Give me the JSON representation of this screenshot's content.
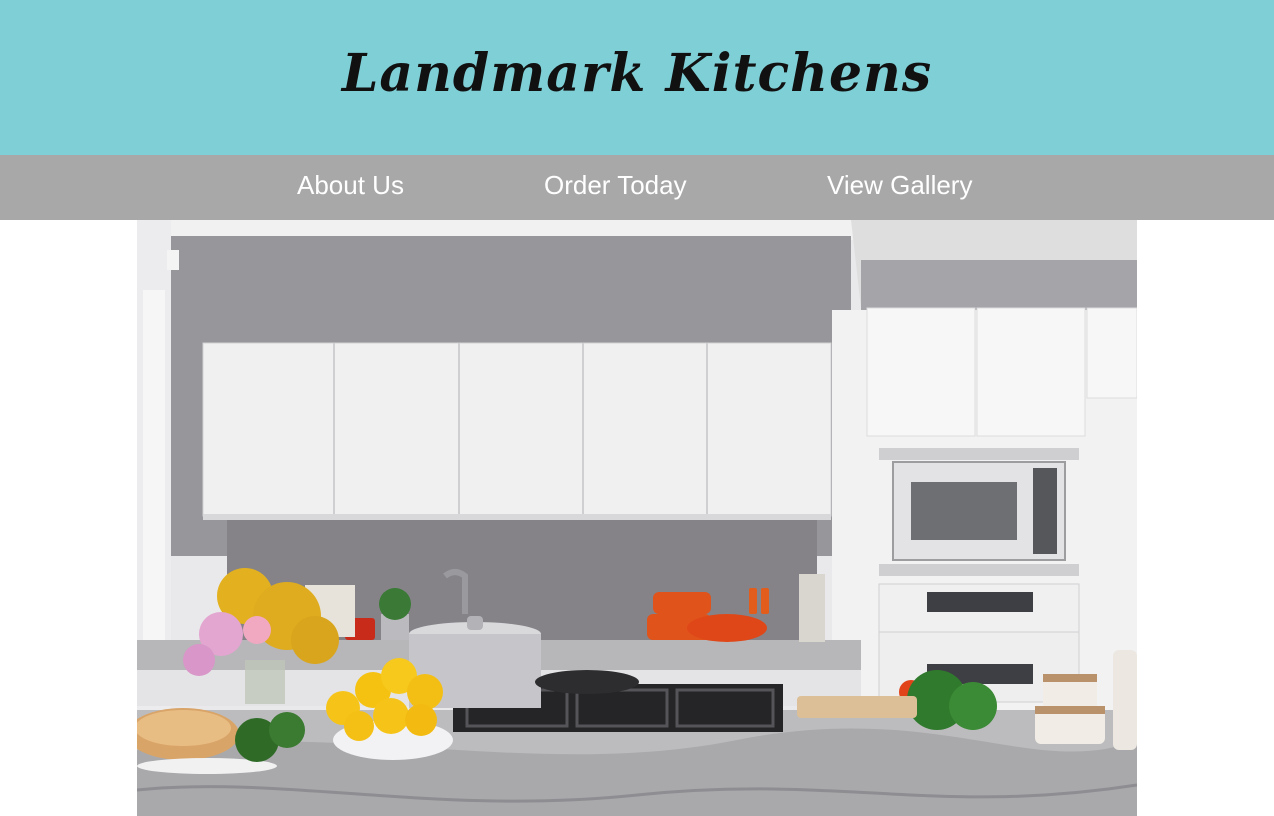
{
  "header": {
    "title": "Landmark Kitchens",
    "background_color": "#7fcfd6"
  },
  "nav": {
    "background_color": "#a8a8a8",
    "items": [
      {
        "label": "About Us"
      },
      {
        "label": "Order Today"
      },
      {
        "label": "View Gallery"
      }
    ]
  },
  "hero": {
    "subject": "kitchen-photo"
  }
}
